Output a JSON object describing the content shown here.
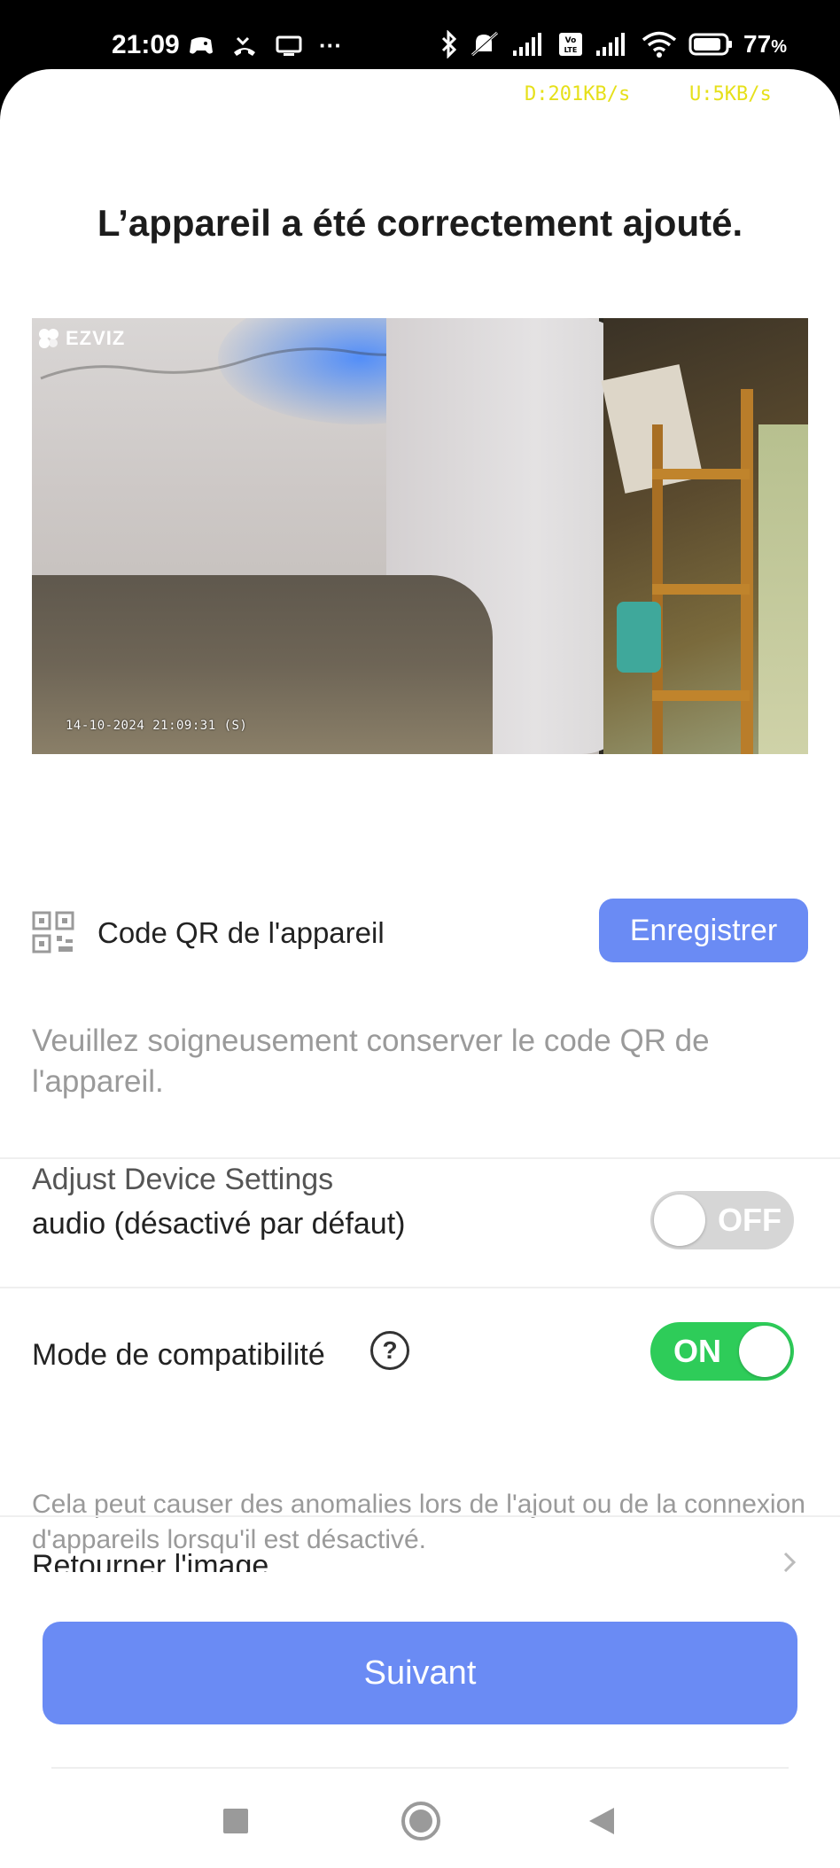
{
  "status_bar": {
    "time": "21:09",
    "more": "···",
    "battery_percent": "77",
    "battery_unit": "%"
  },
  "net_speed": {
    "download": "D:201KB/s",
    "upload": "U:5KB/s"
  },
  "page": {
    "title": "L’appareil a été correctement ajouté."
  },
  "camera": {
    "logo_text": "EZVIZ",
    "timestamp": "14-10-2024 21:09:31  (S)"
  },
  "qr": {
    "label": "Code QR de l'appareil",
    "save_label": "Enregistrer",
    "hint": "Veuillez soigneusement conserver le code QR de l'appareil."
  },
  "settings": {
    "section_title": "Adjust Device Settings",
    "audio": {
      "label": "audio (désactivé par défaut)",
      "state": "OFF"
    },
    "compat": {
      "label": "Mode de compatibilité",
      "help": "?",
      "state": "ON",
      "hint": "Cela peut causer des anomalies lors de l'ajout ou de la connexion d'appareils lorsqu'il est désactivé."
    },
    "flip": {
      "label": "Retourner l'image"
    }
  },
  "footer": {
    "next_label": "Suivant"
  },
  "colors": {
    "accent": "#6a8bf4",
    "toggle_on": "#2ecc59",
    "toggle_off": "#d6d6d6"
  }
}
